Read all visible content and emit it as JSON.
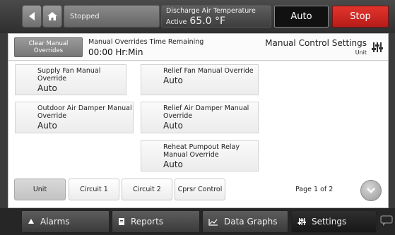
{
  "topbar": {
    "status": "Stopped",
    "discharge_title": "Discharge Air Temperature",
    "discharge_state": "Active",
    "discharge_value": "65.0 °F",
    "auto_label": "Auto",
    "stop_label": "Stop"
  },
  "header": {
    "clear_btn": "Clear Manual Overrides",
    "time_title": "Manual Overrides Time Remaining",
    "time_value": "00:00 Hr:Min",
    "section_title": "Manual Control Settings",
    "section_sub": "Unit"
  },
  "overrides": [
    {
      "label": "Supply Fan Manual Override",
      "value": "Auto"
    },
    {
      "label": "Relief Fan Manual Override",
      "value": "Auto"
    },
    {
      "label": "Outdoor Air Damper Manual Override",
      "value": "Auto"
    },
    {
      "label": "Relief Air Damper Manual Override",
      "value": "Auto"
    },
    {
      "label": "Reheat Pumpout Relay Manual Override",
      "value": "Auto"
    }
  ],
  "tabs": [
    "Unit",
    "Circuit 1",
    "Circuit 2",
    "Cprsr Control"
  ],
  "active_tab": "Unit",
  "page_indicator": "Page 1 of 2",
  "bottom_nav": [
    {
      "label": "Alarms",
      "icon": "bell-icon"
    },
    {
      "label": "Reports",
      "icon": "document-icon"
    },
    {
      "label": "Data Graphs",
      "icon": "graph-icon"
    },
    {
      "label": "Settings",
      "icon": "sliders-icon"
    }
  ],
  "colors": {
    "stop": "#cf2a25",
    "auto": "#111111",
    "active_nav": "#1f1f1f"
  }
}
